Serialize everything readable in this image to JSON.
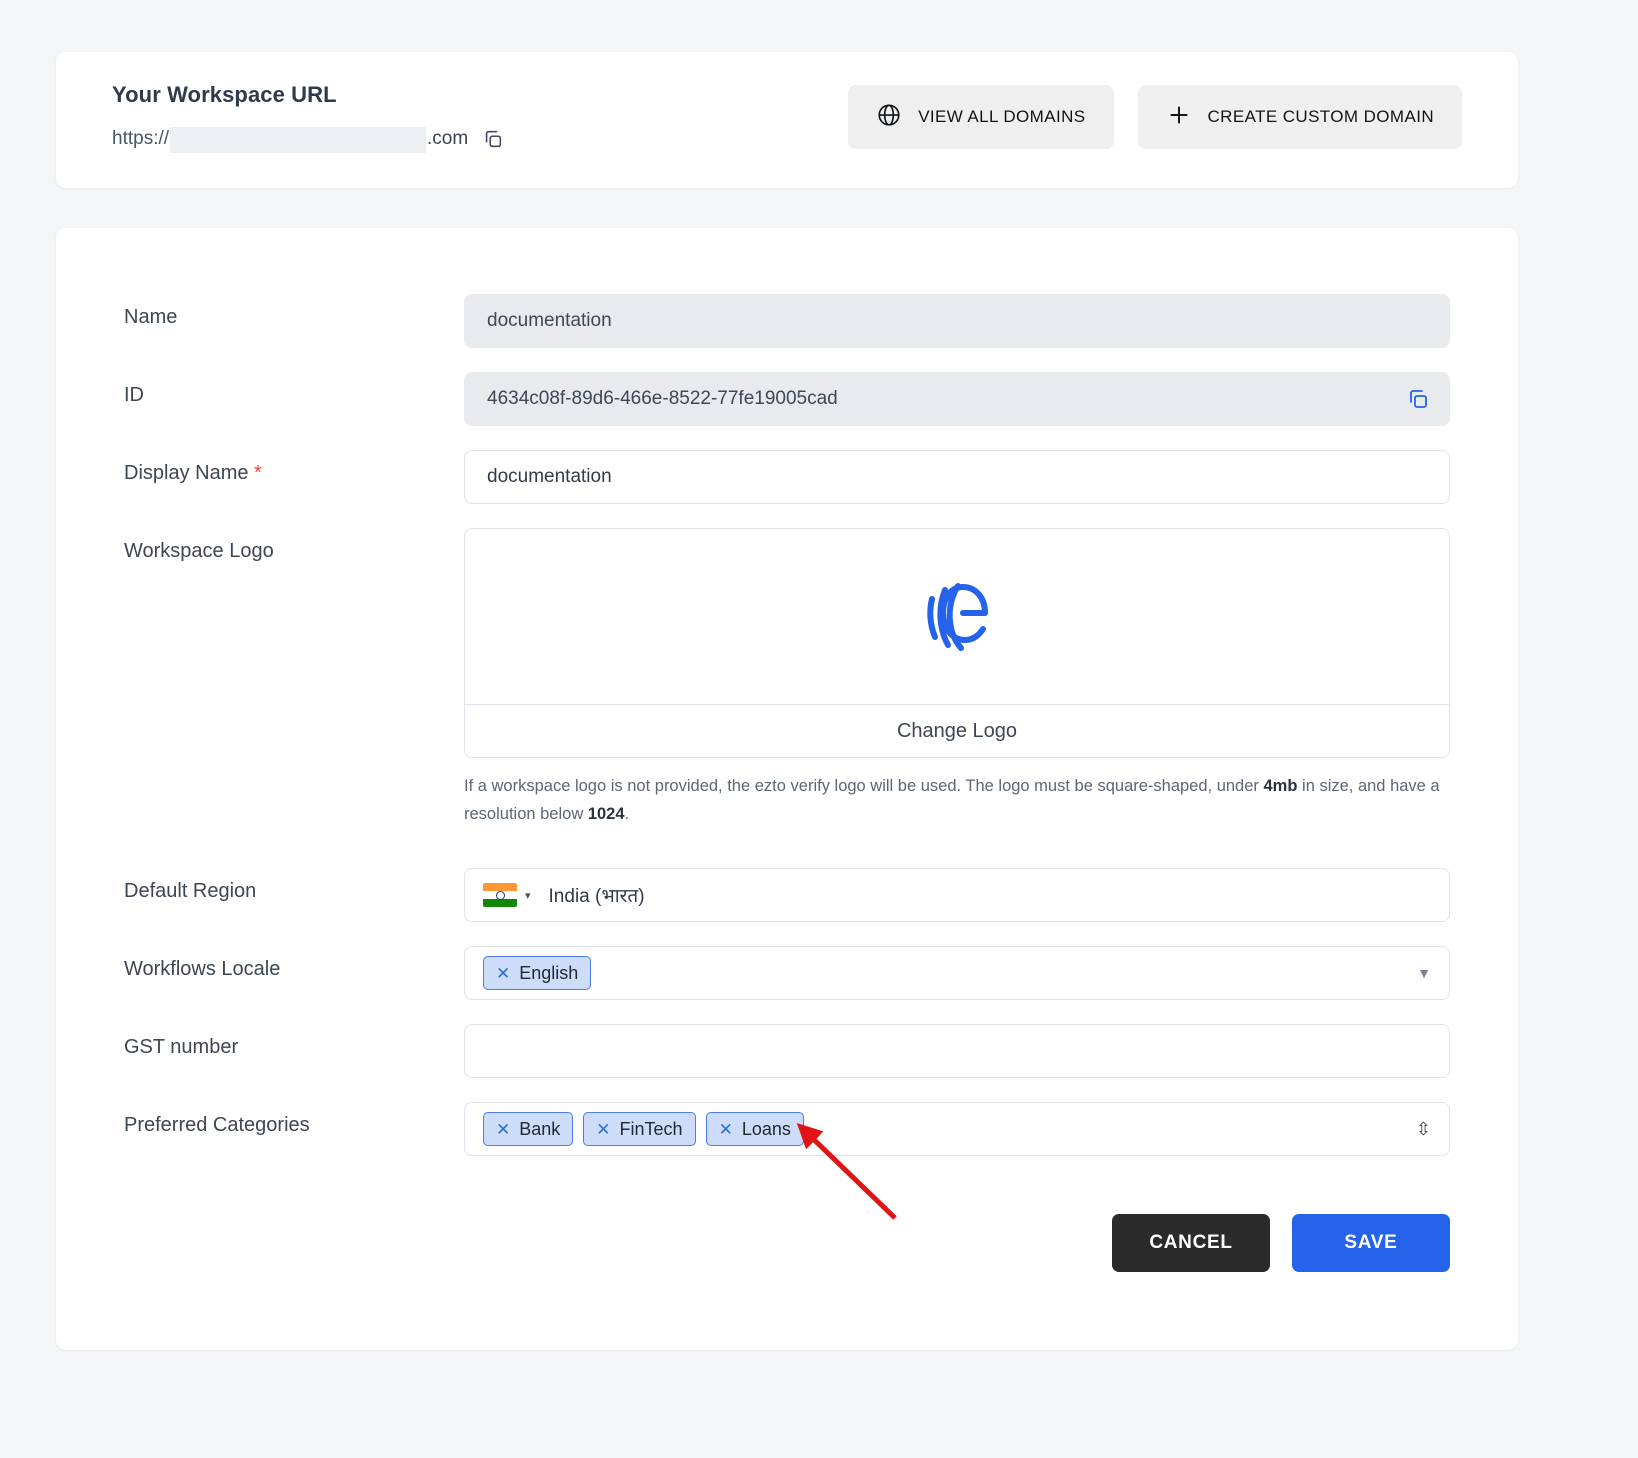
{
  "workspace_url": {
    "title": "Your Workspace URL",
    "scheme": "https://",
    "subdomain_redacted": "",
    "tld": ".com",
    "copy_icon": "copy-icon"
  },
  "top_actions": {
    "view_all_domains": {
      "label": "VIEW ALL DOMAINS",
      "icon": "globe-icon"
    },
    "create_custom_domain": {
      "label": "CREATE CUSTOM DOMAIN",
      "icon": "plus-icon"
    }
  },
  "form": {
    "name": {
      "label": "Name",
      "value": "documentation"
    },
    "id": {
      "label": "ID",
      "value": "4634c08f-89d6-466e-8522-77fe19005cad",
      "copy_icon": "copy-icon"
    },
    "display_name": {
      "label": "Display Name",
      "required_mark": "*",
      "value": "documentation"
    },
    "workspace_logo": {
      "label": "Workspace Logo",
      "logo_icon": "ezto-verify-logo",
      "change_label": "Change Logo",
      "help_prefix": "If a workspace logo is not provided, the ezto verify logo will be used. The logo must be square-shaped, under ",
      "help_bold_1": "4mb",
      "help_middle": " in size, and have a resolution below ",
      "help_bold_2": "1024",
      "help_suffix": "."
    },
    "default_region": {
      "label": "Default Region",
      "flag": "india-flag-icon",
      "value": "India (भारत)",
      "caret": "▾"
    },
    "workflows_locale": {
      "label": "Workflows Locale",
      "tags": [
        "English"
      ],
      "caret": "▼"
    },
    "gst_number": {
      "label": "GST number",
      "value": "",
      "placeholder": ""
    },
    "preferred_categories": {
      "label": "Preferred Categories",
      "tags": [
        "Bank",
        "FinTech",
        "Loans"
      ],
      "stepper": "⇳"
    }
  },
  "footer": {
    "cancel_label": "CANCEL",
    "save_label": "SAVE"
  },
  "colors": {
    "accent_blue": "#2563eb",
    "tag_border": "#4b7bec",
    "tag_bg": "#ccdcf9",
    "cancel_dark": "#2b2b2b",
    "annotation_red": "#e11414",
    "page_bg": "#f4f5f7"
  }
}
